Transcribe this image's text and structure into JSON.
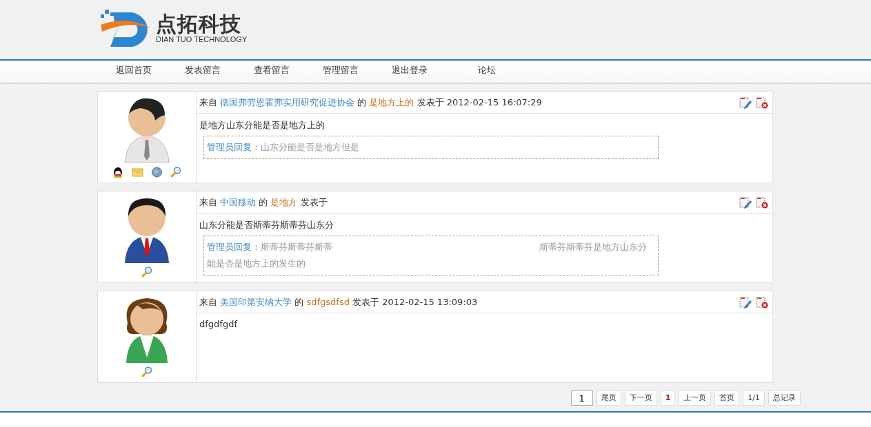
{
  "logo": {
    "name": "点拓科技",
    "subtitle": "DIAN TUO TECHNOLOGY"
  },
  "nav": [
    "返回首页",
    "发表留言",
    "查看留言",
    "管理留言",
    "退出登录",
    "论坛"
  ],
  "posts": [
    {
      "avatar": {
        "kind": "doctor"
      },
      "links": [
        {
          "kind": "qq"
        },
        {
          "kind": "email"
        },
        {
          "kind": "web"
        },
        {
          "kind": "search"
        }
      ],
      "from_label": "来自",
      "place": "德国弗劳恩霍弗实用研究促进协会",
      "of_label": "的",
      "author": "是地方上的",
      "posted_label": "发表于",
      "time": "2012-02-15 16:07:29",
      "body": "是地方山东分能是否是地方上的",
      "reply_label": "管理员回复：",
      "reply": [
        "山东分能是否是地方但是"
      ]
    },
    {
      "avatar": {
        "kind": "suit"
      },
      "links": [
        {
          "kind": "search"
        }
      ],
      "from_label": "来自",
      "place": "中国移动",
      "of_label": "的",
      "author": "是地方",
      "posted_label": "发表于",
      "body": "山东分能是否斯蒂芬斯蒂芬山东分",
      "reply_label": "管理员回复：",
      "reply": [
        "斯蒂芬斯蒂芬斯蒂",
        "斯蒂芬斯蒂芬是地方山东分能是否是地方上的发生的"
      ]
    },
    {
      "avatar": {
        "kind": "woman"
      },
      "links": [
        {
          "kind": "search"
        }
      ],
      "from_label": "来自",
      "place": "美国印第安纳大学",
      "of_label": "的",
      "author": "sdfgsdfsd",
      "posted_label": "发表于",
      "time": "2012-02-15 13:09:03",
      "body": "dfgdfgdf"
    }
  ],
  "pager": {
    "page_input": "1",
    "items": [
      {
        "label": "尾页",
        "current": false
      },
      {
        "label": "下一页",
        "current": false
      },
      {
        "label": "1",
        "current": true
      },
      {
        "label": "上一页",
        "current": false
      },
      {
        "label": "首页",
        "current": false
      },
      {
        "label": "1/1",
        "current": false
      },
      {
        "label": "总记录",
        "current": false
      }
    ]
  }
}
